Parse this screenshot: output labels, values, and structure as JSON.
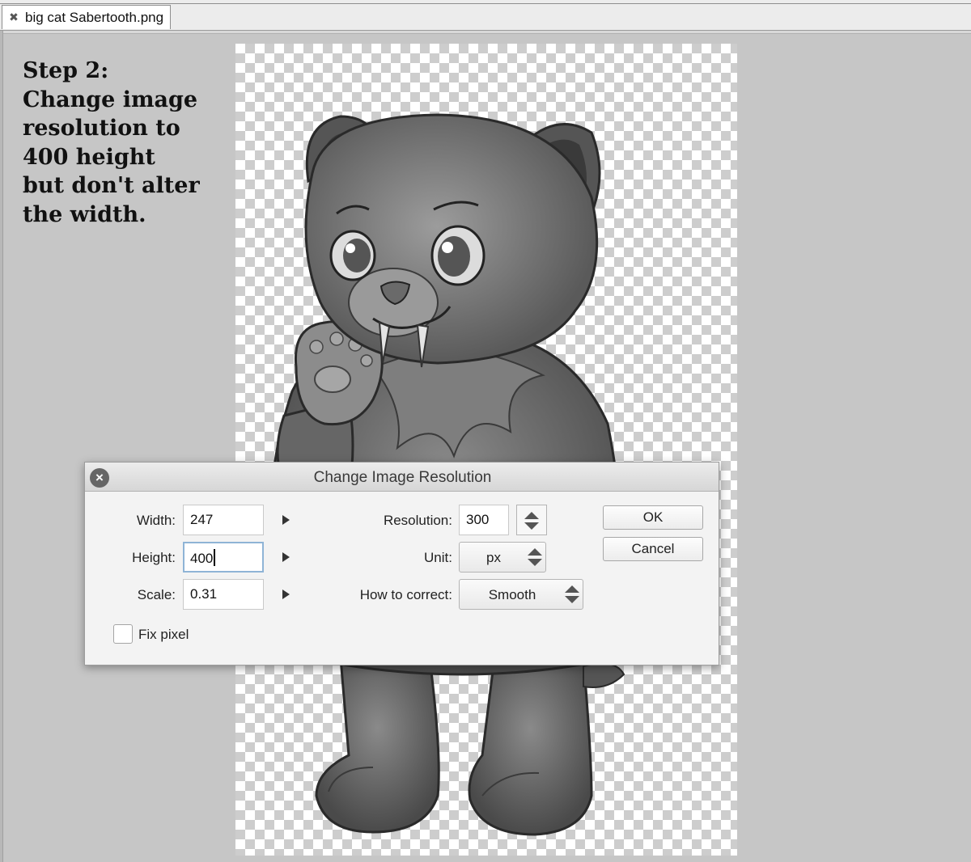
{
  "tab": {
    "close_glyph": "✖",
    "title": "big cat Sabertooth.png"
  },
  "instructions": {
    "lines": [
      "Step 2:",
      "Change image",
      "resolution to",
      "400 height",
      "but don't alter",
      "the width."
    ]
  },
  "dialog": {
    "title": "Change Image Resolution",
    "close_glyph": "×",
    "width": {
      "label": "Width:",
      "value": "247"
    },
    "height": {
      "label": "Height:",
      "value": "400"
    },
    "scale": {
      "label": "Scale:",
      "value": "0.31"
    },
    "resolution": {
      "label": "Resolution:",
      "value": "300"
    },
    "unit": {
      "label": "Unit:",
      "value": "px"
    },
    "correction": {
      "label": "How to correct:",
      "value": "Smooth"
    },
    "ok_label": "OK",
    "cancel_label": "Cancel",
    "fix_pixel": {
      "label": "Fix pixel",
      "checked": false
    }
  },
  "icons": {
    "tab_close": "close-icon",
    "dialog_close": "close-circle-icon",
    "expand": "triangle-right-icon",
    "spinner": "up-down-arrows-icon"
  }
}
